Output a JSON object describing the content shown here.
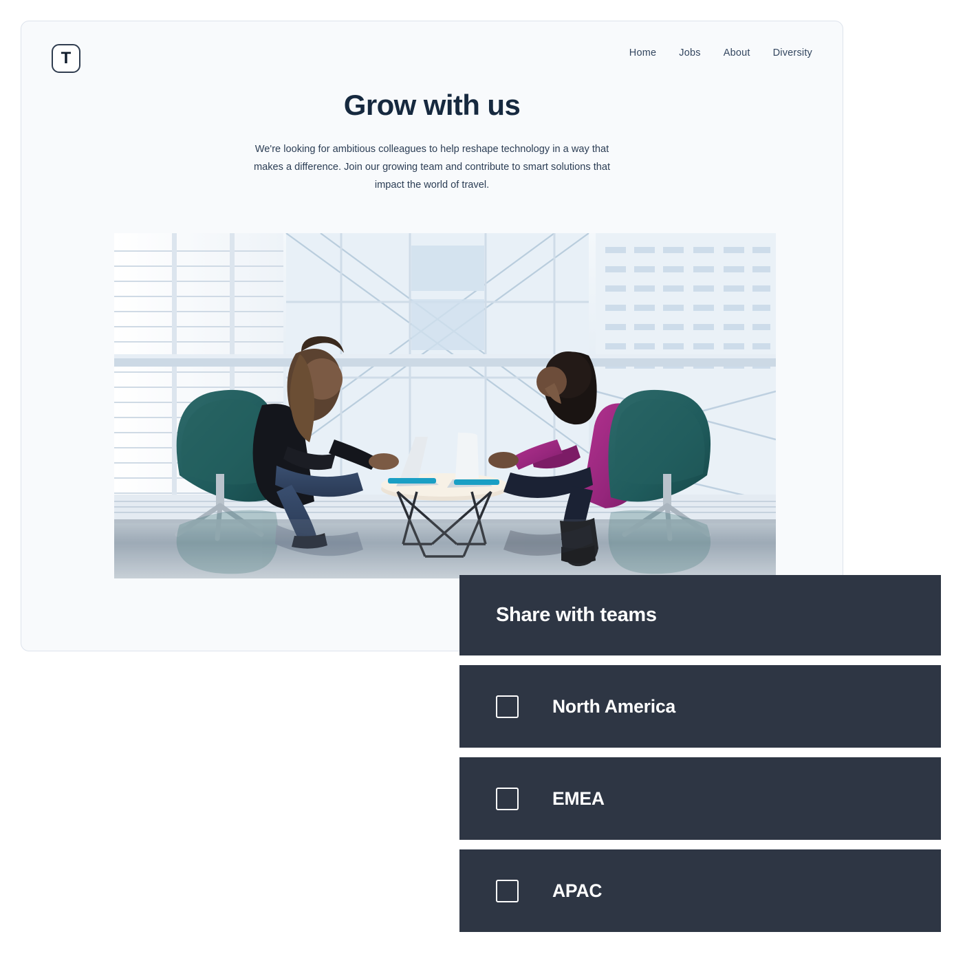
{
  "site": {
    "logo_letter": "T",
    "nav": [
      {
        "label": "Home"
      },
      {
        "label": "Jobs"
      },
      {
        "label": "About"
      },
      {
        "label": "Diversity"
      }
    ]
  },
  "hero": {
    "title": "Grow with us",
    "paragraph": "We're looking for ambitious colleagues to help reshape technology in a way that makes a difference. Join our growing team and contribute to smart solutions that impact the world of travel.",
    "image_alt": "Two colleagues working on laptops at a round table in a glass-walled office"
  },
  "share_panel": {
    "title": "Share with teams",
    "teams": [
      {
        "label": "North America",
        "checked": false
      },
      {
        "label": "EMEA",
        "checked": false
      },
      {
        "label": "APAC",
        "checked": false
      }
    ]
  },
  "colors": {
    "page_bg": "#f8fafc",
    "card_border": "#dde3ec",
    "heading": "#16293f",
    "body_text": "#2b3d54",
    "nav_text": "#33465f",
    "panel_bg": "#2e3644",
    "panel_text": "#ffffff"
  }
}
